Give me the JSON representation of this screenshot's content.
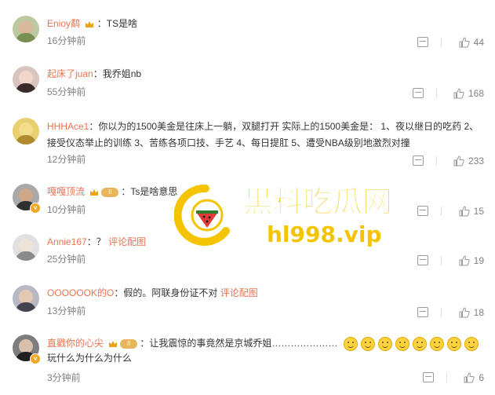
{
  "watermark": {
    "title": "黑料吃瓜网",
    "url": "hl998.vip"
  },
  "comments": [
    {
      "name": "Enioy鹬",
      "badge": "crown",
      "sep": "：",
      "text": "TS是啥",
      "time": "16分钟前",
      "likes": "44"
    },
    {
      "name": "起床了juan",
      "sep": "：",
      "text": "我乔姐nb",
      "time": "55分钟前",
      "likes": "168"
    },
    {
      "name": "HHHAce1",
      "sep": "：",
      "text": "你以为的1500美金是往床上一躺，双腿打开 实际上的1500美金是： 1、夜以继日的吃药 2、接受仪态举止的训练 3、苦练各项口技、手艺 4、每日提肛 5、遭受NBA级别地激烈对撞",
      "time": "12分钟前",
      "likes": "233"
    },
    {
      "name": "嘎嘎顶流",
      "badge": "level",
      "sep": "：",
      "text": "Ts是啥意思",
      "time": "10分钟前",
      "likes": "15"
    },
    {
      "name": "Annie167",
      "sep": "：",
      "text": "？",
      "link": "评论配图",
      "time": "25分钟前",
      "likes": "19"
    },
    {
      "name": "OOOOOOK的O",
      "sep": "：",
      "text": "假的。阿联身份证不对",
      "link": "评论配图",
      "time": "13分钟前",
      "likes": "18"
    },
    {
      "name": "直戳你的心尖",
      "badge": "level",
      "sep": "：",
      "text": "让我震惊的事竟然是京城乔姐…………………",
      "text2": "玩什么为什么为什么",
      "time": "3分钟前",
      "likes": "6"
    }
  ],
  "level_label": "II",
  "v_label": "v",
  "colors": {
    "name": "#eb7350",
    "watermark_yellow": "#f5c400"
  }
}
